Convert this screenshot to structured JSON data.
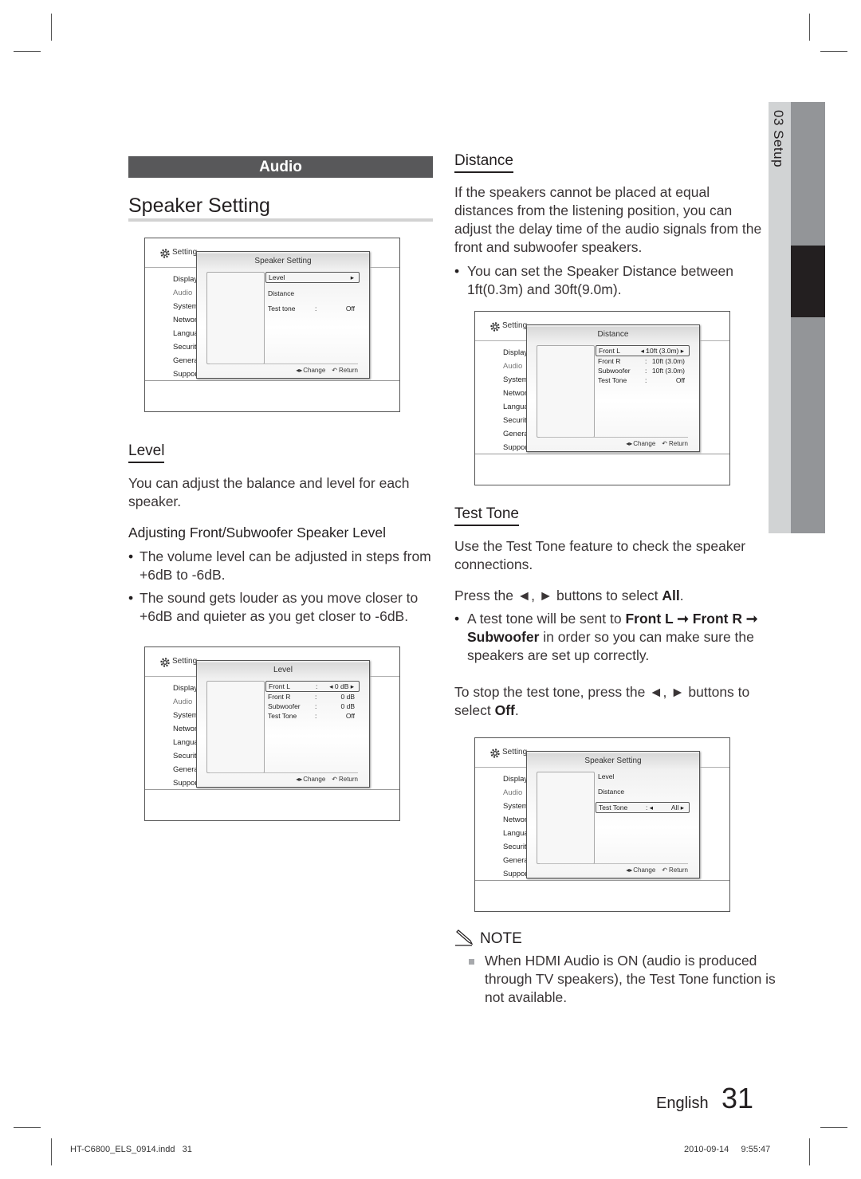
{
  "section": "Audio",
  "page_title": "Speaker Setting",
  "side_tab": {
    "label": "03 Setup"
  },
  "common_screen": {
    "settings_label": "Setting",
    "menu": [
      "Display",
      "Audio",
      "System",
      "Networ",
      "Langua",
      "Securit",
      "Genera",
      "Suppor"
    ],
    "active_menu": "Audio",
    "footer_change": "Change",
    "footer_return": "Return",
    "change_icon": "left-right-arrows-icon",
    "return_icon": "return-arrow-icon"
  },
  "screens": {
    "speaker_setting": {
      "title": "Speaker Setting",
      "rows": [
        {
          "label": "Level",
          "colon": "",
          "value": "▸",
          "selected": true
        },
        {
          "label": "Distance",
          "colon": "",
          "value": "",
          "selected": false
        },
        {
          "label": "Test tone",
          "colon": ":",
          "value": "Off",
          "selected": false
        }
      ]
    },
    "level": {
      "title": "Level",
      "rows": [
        {
          "label": "Front L",
          "colon": ":",
          "value": "◂ 0 dB ▸",
          "selected": true
        },
        {
          "label": "Front R",
          "colon": ":",
          "value": "0 dB",
          "selected": false
        },
        {
          "label": "Subwoofer",
          "colon": ":",
          "value": "0 dB",
          "selected": false
        },
        {
          "label": "Test Tone",
          "colon": ":",
          "value": "Off",
          "selected": false
        }
      ]
    },
    "distance": {
      "title": "Distance",
      "rows": [
        {
          "label": "Front L",
          "colon": ":",
          "value": "◂ 10ft (3.0m) ▸",
          "selected": true
        },
        {
          "label": "Front R",
          "colon": ":",
          "value": "10ft (3.0m)",
          "selected": false
        },
        {
          "label": "Subwoofer",
          "colon": ":",
          "value": "10ft (3.0m)",
          "selected": false
        },
        {
          "label": "Test Tone",
          "colon": ":",
          "value": "Off",
          "selected": false
        }
      ]
    },
    "test_tone": {
      "title": "Speaker Setting",
      "rows": [
        {
          "label": "Level",
          "colon": "",
          "value": "",
          "selected": false
        },
        {
          "label": "Distance",
          "colon": "",
          "value": "",
          "selected": false
        },
        {
          "label": "Test Tone",
          "colon": ": ◂",
          "value": "All   ▸",
          "selected": true
        }
      ]
    }
  },
  "level_section": {
    "heading": "Level",
    "intro": "You can adjust the balance and level for each speaker.",
    "subheading": "Adjusting Front/Subwoofer Speaker Level",
    "bullets": [
      "The volume level can be adjusted in steps from +6dB to -6dB.",
      "The sound gets louder as you move closer to +6dB and quieter as you get closer to -6dB."
    ]
  },
  "distance_section": {
    "heading": "Distance",
    "intro": "If the speakers cannot be placed at equal distances from the listening position, you can adjust the delay time of the audio signals from the front and subwoofer speakers.",
    "bullets": [
      "You can set the Speaker Distance between 1ft(0.3m) and 30ft(9.0m)."
    ]
  },
  "test_tone_section": {
    "heading": "Test Tone",
    "intro": "Use the Test Tone feature to check the speaker connections.",
    "press_pre": "Press the ◄, ► buttons to select ",
    "press_bold": "All",
    "press_post": ".",
    "bullet_pre": "A test tone will be sent to ",
    "bullet_bold1": "Front L ➞ Front R ➞ Subwoofer",
    "bullet_post": " in order so you can make sure the speakers are set up correctly.",
    "stop_pre": "To stop the test tone, press the ◄, ► buttons to select ",
    "stop_bold": "Off",
    "stop_post": "."
  },
  "note": {
    "icon": "pencil-note-icon",
    "heading": "NOTE",
    "items": [
      "When HDMI Audio is ON (audio is produced through TV speakers), the Test Tone function is not available."
    ]
  },
  "page_footer": {
    "language": "English",
    "page_number": "31",
    "file_info": "HT-C6800_ELS_0914.indd   31",
    "date_time": "2010-09-14     9:55:47"
  }
}
